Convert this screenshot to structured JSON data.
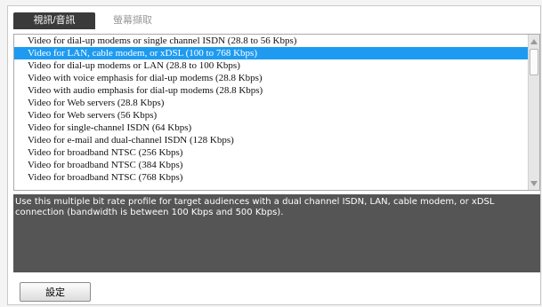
{
  "tabs": [
    {
      "label": "視訊/音訊",
      "active": true
    },
    {
      "label": "螢幕擷取",
      "active": false
    }
  ],
  "profiles": [
    "Video for dial-up modems or single channel ISDN (28.8 to 56 Kbps)",
    "Video for LAN, cable modem, or xDSL (100 to 768 Kbps)",
    "Video for dial-up modems or LAN (28.8 to 100 Kbps)",
    "Video with voice emphasis for dial-up modems (28.8 Kbps)",
    "Video with audio emphasis for dial-up modems (28.8 Kbps)",
    "Video for Web servers (28.8 Kbps)",
    "Video for Web servers (56 Kbps)",
    "Video for single-channel ISDN (64 Kbps)",
    "Video for e-mail and dual-channel ISDN (128 Kbps)",
    "Video for broadband NTSC (256 Kbps)",
    "Video for broadband NTSC (384 Kbps)",
    "Video for broadband NTSC (768 Kbps)"
  ],
  "selected_index": 1,
  "description": "Use this multiple bit rate profile for target audiences with a dual channel ISDN, LAN, cable modem, or xDSL connection (bandwidth is between 100 Kbps and 500 Kbps).",
  "settings_button_label": "設定",
  "colors": {
    "selection": "#1e9bf0",
    "description_bg": "#555555",
    "active_tab_bg": "#3a3a3a"
  }
}
